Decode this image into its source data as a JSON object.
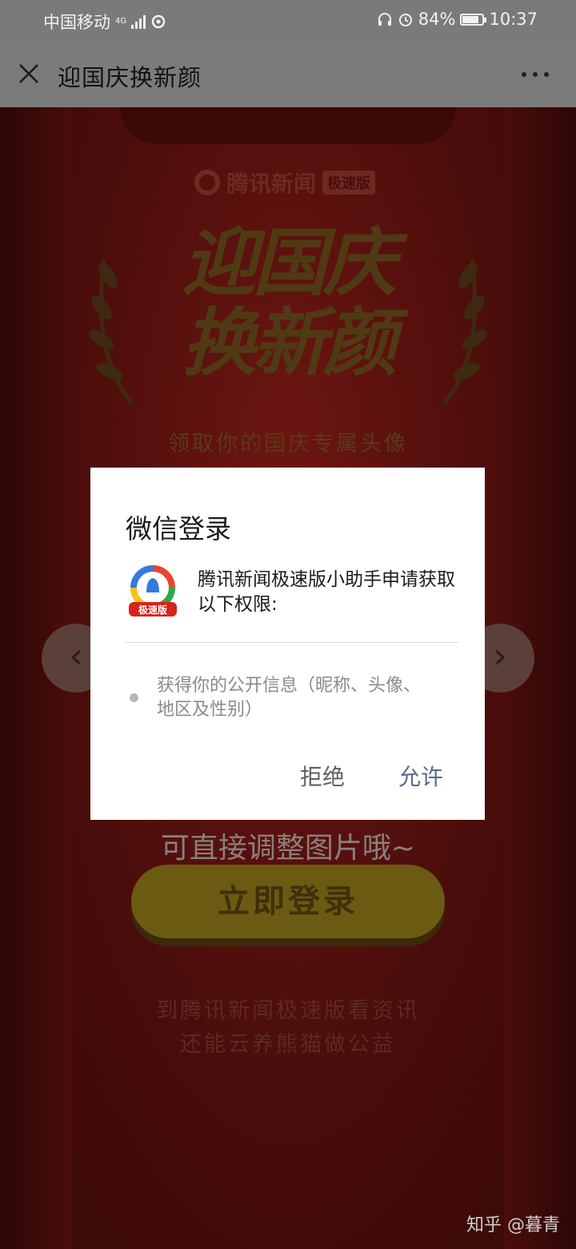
{
  "status_bar": {
    "carrier": "中国移动",
    "network": "4G",
    "battery": "84%",
    "battery_level": 0.84,
    "time": "10:37"
  },
  "nav": {
    "title": "迎国庆换新颜",
    "close_icon": "close-icon",
    "more_icon": "more-icon"
  },
  "page": {
    "brand": "腾讯新闻",
    "brand_tag": "极速版",
    "hero_line1": "迎国庆",
    "hero_line2": "换新颜",
    "hero_subtitle": "领取你的国庆专属头像",
    "hint": "可直接调整图片哦~",
    "login_button": "立即登录",
    "promo_line1": "到腾讯新闻极速版看资讯",
    "promo_line2": "还能云养熊猫做公益",
    "prev_icon": "chevron-left-icon",
    "next_icon": "chevron-right-icon"
  },
  "dialog": {
    "title": "微信登录",
    "app_icon_label": "极速版",
    "request_text": "腾讯新闻极速版小助手申请获取以下权限:",
    "permission": "获得你的公开信息（昵称、头像、地区及性别）",
    "deny_label": "拒绝",
    "allow_label": "允许",
    "allow_color": "#566b90"
  },
  "watermark": "知乎 @暮青"
}
